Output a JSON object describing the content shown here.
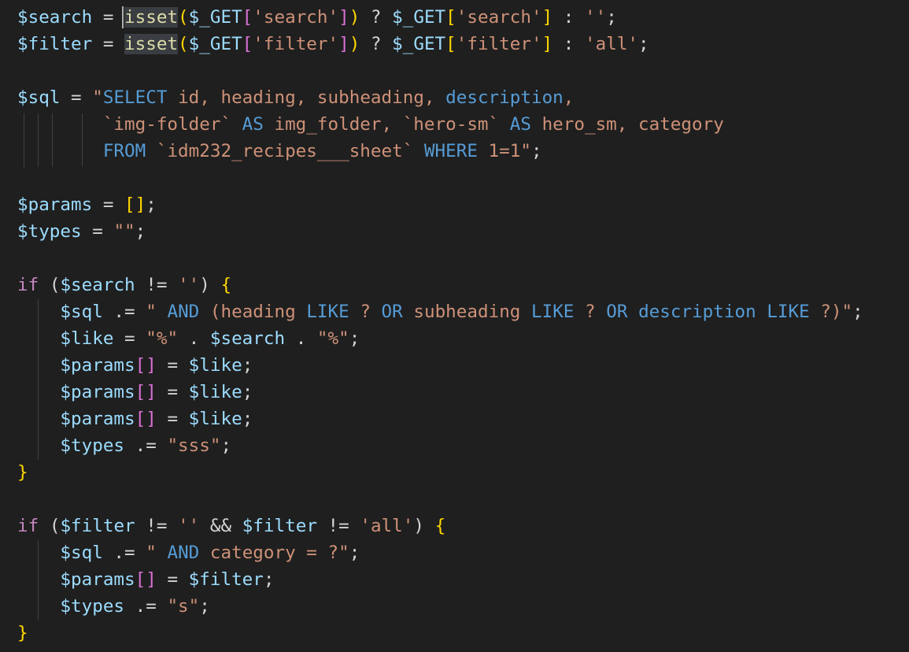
{
  "editor": {
    "language": "php",
    "lines": [
      [
        {
          "t": "$search",
          "c": "v"
        },
        {
          "t": " = ",
          "c": "p"
        },
        {
          "t": "isset",
          "c": "f",
          "hl": true
        },
        {
          "t": "(",
          "c": "b1"
        },
        {
          "t": "$_GET",
          "c": "v"
        },
        {
          "t": "[",
          "c": "b2"
        },
        {
          "t": "'search'",
          "c": "s"
        },
        {
          "t": "]",
          "c": "b2"
        },
        {
          "t": ")",
          "c": "b1"
        },
        {
          "t": " ? ",
          "c": "p"
        },
        {
          "t": "$_GET",
          "c": "v"
        },
        {
          "t": "[",
          "c": "b1"
        },
        {
          "t": "'search'",
          "c": "s"
        },
        {
          "t": "]",
          "c": "b1"
        },
        {
          "t": " : ",
          "c": "p"
        },
        {
          "t": "''",
          "c": "s"
        },
        {
          "t": ";",
          "c": "p"
        }
      ],
      [
        {
          "t": "$filter",
          "c": "v"
        },
        {
          "t": " = ",
          "c": "p"
        },
        {
          "t": "isset",
          "c": "f",
          "hl": true
        },
        {
          "t": "(",
          "c": "b1"
        },
        {
          "t": "$_GET",
          "c": "v"
        },
        {
          "t": "[",
          "c": "b2"
        },
        {
          "t": "'filter'",
          "c": "s"
        },
        {
          "t": "]",
          "c": "b2"
        },
        {
          "t": ")",
          "c": "b1"
        },
        {
          "t": " ? ",
          "c": "p"
        },
        {
          "t": "$_GET",
          "c": "v"
        },
        {
          "t": "[",
          "c": "b1"
        },
        {
          "t": "'filter'",
          "c": "s"
        },
        {
          "t": "]",
          "c": "b1"
        },
        {
          "t": " : ",
          "c": "p"
        },
        {
          "t": "'all'",
          "c": "s"
        },
        {
          "t": ";",
          "c": "p"
        }
      ],
      [],
      [
        {
          "t": "$sql",
          "c": "v"
        },
        {
          "t": " = ",
          "c": "p"
        },
        {
          "t": "\"",
          "c": "s"
        },
        {
          "t": "SELECT",
          "c": "k"
        },
        {
          "t": " id, heading, subheading, ",
          "c": "s"
        },
        {
          "t": "description",
          "c": "k"
        },
        {
          "t": ",",
          "c": "s"
        }
      ],
      [
        {
          "t": "        `img-folder` ",
          "c": "s"
        },
        {
          "t": "AS",
          "c": "k"
        },
        {
          "t": " img_folder, `hero-sm` ",
          "c": "s"
        },
        {
          "t": "AS",
          "c": "k"
        },
        {
          "t": " hero_sm, category",
          "c": "s"
        }
      ],
      [
        {
          "t": "        ",
          "c": "s"
        },
        {
          "t": "FROM",
          "c": "k"
        },
        {
          "t": " `idm232_recipes___sheet` ",
          "c": "s"
        },
        {
          "t": "WHERE",
          "c": "k"
        },
        {
          "t": " 1=1",
          "c": "s"
        },
        {
          "t": "\"",
          "c": "s"
        },
        {
          "t": ";",
          "c": "p"
        }
      ],
      [],
      [
        {
          "t": "$params",
          "c": "v"
        },
        {
          "t": " = ",
          "c": "p"
        },
        {
          "t": "[]",
          "c": "b1"
        },
        {
          "t": ";",
          "c": "p"
        }
      ],
      [
        {
          "t": "$types",
          "c": "v"
        },
        {
          "t": " = ",
          "c": "p"
        },
        {
          "t": "\"\"",
          "c": "s"
        },
        {
          "t": ";",
          "c": "p"
        }
      ],
      [],
      [
        {
          "t": "if",
          "c": "c"
        },
        {
          "t": " (",
          "c": "p"
        },
        {
          "t": "$search",
          "c": "v"
        },
        {
          "t": " != ",
          "c": "p"
        },
        {
          "t": "''",
          "c": "s"
        },
        {
          "t": ") ",
          "c": "p"
        },
        {
          "t": "{",
          "c": "b1"
        }
      ],
      [
        {
          "t": "    $sql",
          "c": "v"
        },
        {
          "t": " .= ",
          "c": "p"
        },
        {
          "t": "\" ",
          "c": "s"
        },
        {
          "t": "AND",
          "c": "k"
        },
        {
          "t": " (heading ",
          "c": "s"
        },
        {
          "t": "LIKE",
          "c": "k"
        },
        {
          "t": " ? ",
          "c": "s"
        },
        {
          "t": "OR",
          "c": "k"
        },
        {
          "t": " subheading ",
          "c": "s"
        },
        {
          "t": "LIKE",
          "c": "k"
        },
        {
          "t": " ? ",
          "c": "s"
        },
        {
          "t": "OR",
          "c": "k"
        },
        {
          "t": " ",
          "c": "s"
        },
        {
          "t": "description",
          "c": "k"
        },
        {
          "t": " ",
          "c": "s"
        },
        {
          "t": "LIKE",
          "c": "k"
        },
        {
          "t": " ?)\"",
          "c": "s"
        },
        {
          "t": ";",
          "c": "p"
        }
      ],
      [
        {
          "t": "    $like",
          "c": "v"
        },
        {
          "t": " = ",
          "c": "p"
        },
        {
          "t": "\"%\"",
          "c": "s"
        },
        {
          "t": " . ",
          "c": "p"
        },
        {
          "t": "$search",
          "c": "v"
        },
        {
          "t": " . ",
          "c": "p"
        },
        {
          "t": "\"%\"",
          "c": "s"
        },
        {
          "t": ";",
          "c": "p"
        }
      ],
      [
        {
          "t": "    $params",
          "c": "v"
        },
        {
          "t": "[]",
          "c": "b2"
        },
        {
          "t": " = ",
          "c": "p"
        },
        {
          "t": "$like",
          "c": "v"
        },
        {
          "t": ";",
          "c": "p"
        }
      ],
      [
        {
          "t": "    $params",
          "c": "v"
        },
        {
          "t": "[]",
          "c": "b2"
        },
        {
          "t": " = ",
          "c": "p"
        },
        {
          "t": "$like",
          "c": "v"
        },
        {
          "t": ";",
          "c": "p"
        }
      ],
      [
        {
          "t": "    $params",
          "c": "v"
        },
        {
          "t": "[]",
          "c": "b2"
        },
        {
          "t": " = ",
          "c": "p"
        },
        {
          "t": "$like",
          "c": "v"
        },
        {
          "t": ";",
          "c": "p"
        }
      ],
      [
        {
          "t": "    $types",
          "c": "v"
        },
        {
          "t": " .= ",
          "c": "p"
        },
        {
          "t": "\"sss\"",
          "c": "s"
        },
        {
          "t": ";",
          "c": "p"
        }
      ],
      [
        {
          "t": "}",
          "c": "b1"
        }
      ],
      [],
      [
        {
          "t": "if",
          "c": "c"
        },
        {
          "t": " (",
          "c": "p"
        },
        {
          "t": "$filter",
          "c": "v"
        },
        {
          "t": " != ",
          "c": "p"
        },
        {
          "t": "''",
          "c": "s"
        },
        {
          "t": " && ",
          "c": "p"
        },
        {
          "t": "$filter",
          "c": "v"
        },
        {
          "t": " != ",
          "c": "p"
        },
        {
          "t": "'all'",
          "c": "s"
        },
        {
          "t": ") ",
          "c": "p"
        },
        {
          "t": "{",
          "c": "b1"
        }
      ],
      [
        {
          "t": "    $sql",
          "c": "v"
        },
        {
          "t": " .= ",
          "c": "p"
        },
        {
          "t": "\" ",
          "c": "s"
        },
        {
          "t": "AND",
          "c": "k"
        },
        {
          "t": " category = ?\"",
          "c": "s"
        },
        {
          "t": ";",
          "c": "p"
        }
      ],
      [
        {
          "t": "    $params",
          "c": "v"
        },
        {
          "t": "[]",
          "c": "b2"
        },
        {
          "t": " = ",
          "c": "p"
        },
        {
          "t": "$filter",
          "c": "v"
        },
        {
          "t": ";",
          "c": "p"
        }
      ],
      [
        {
          "t": "    $types",
          "c": "v"
        },
        {
          "t": " .= ",
          "c": "p"
        },
        {
          "t": "\"s\"",
          "c": "s"
        },
        {
          "t": ";",
          "c": "p"
        }
      ],
      [
        {
          "t": "}",
          "c": "b1"
        }
      ]
    ]
  }
}
